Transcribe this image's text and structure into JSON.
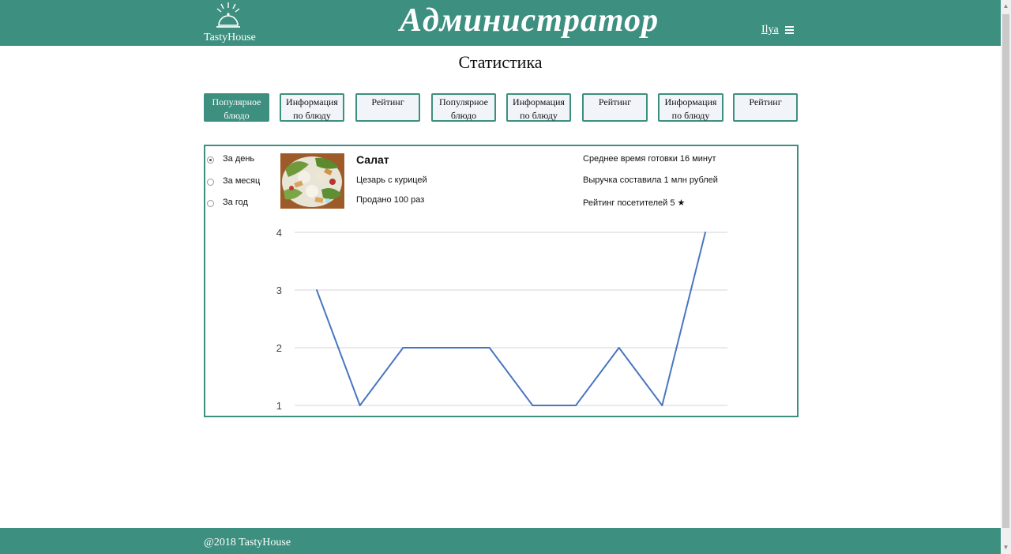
{
  "header": {
    "logo_text": "TastyHouse",
    "title": "Администратор",
    "user": "Ilya"
  },
  "page_title": "Статистика",
  "tabs": [
    {
      "label": "Популярное блюдо",
      "active": true
    },
    {
      "label": "Информация по блюду",
      "active": false
    },
    {
      "label": "Рейтинг",
      "active": false
    },
    {
      "label": "Популярное блюдо",
      "active": false
    },
    {
      "label": "Информация по блюду",
      "active": false
    },
    {
      "label": "Рейтинг",
      "active": false
    },
    {
      "label": "Информация по блюду",
      "active": false
    },
    {
      "label": "Рейтинг",
      "active": false
    }
  ],
  "period": {
    "options": [
      {
        "label": "За день",
        "checked": true
      },
      {
        "label": "За месяц",
        "checked": false
      },
      {
        "label": "За год",
        "checked": false
      }
    ]
  },
  "dish": {
    "name": "Салат",
    "description": "Цезарь с курицей",
    "sold": "Продано 100 раз"
  },
  "stats": {
    "cook_time": "Среднее время готовки 16 минут",
    "revenue": "Выручка составила 1 млн рублей",
    "rating": "Рейтинг посетителей  5 ★"
  },
  "chart_data": {
    "type": "line",
    "title": "",
    "xlabel": "",
    "ylabel": "",
    "ylim": [
      1,
      4
    ],
    "yticks": [
      1,
      2,
      3,
      4
    ],
    "grid": true,
    "color": "#4a76c0",
    "x": [
      1,
      2,
      3,
      4,
      5,
      6,
      7,
      8,
      9,
      10
    ],
    "values": [
      3,
      1,
      2,
      2,
      2,
      1,
      1,
      2,
      1,
      4
    ]
  },
  "footer": {
    "text": "@2018 TastyHouse"
  },
  "colors": {
    "brand": "#3d8f7f",
    "tab_bg": "#f1f4f9",
    "line": "#4a76c0"
  }
}
